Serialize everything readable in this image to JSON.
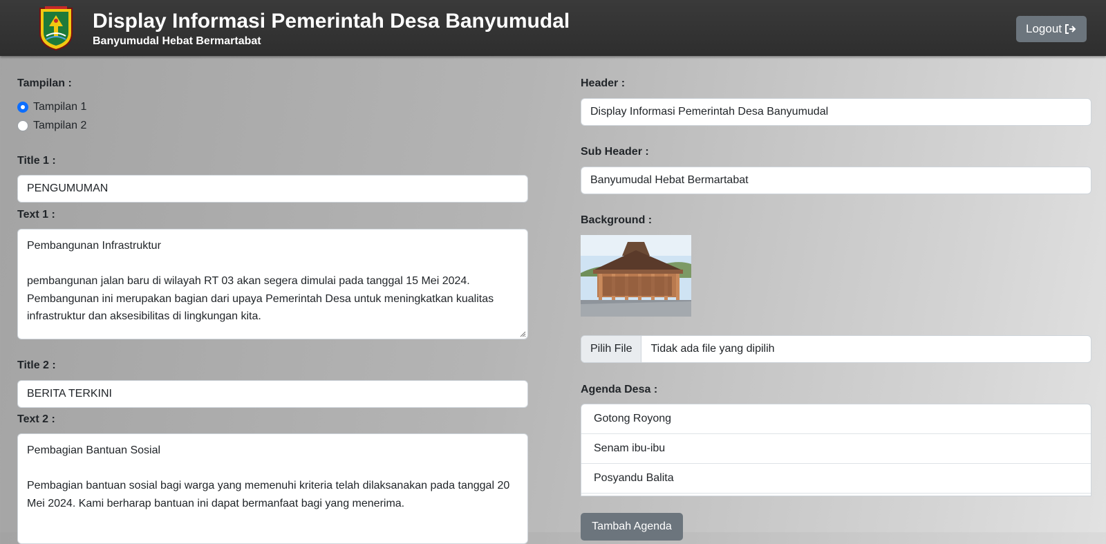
{
  "header": {
    "title": "Display Informasi Pemerintah Desa Banyumudal",
    "subtitle": "Banyumudal Hebat Bermartabat",
    "logout_label": "Logout",
    "logo_icon": "village-emblem-icon",
    "logout_icon": "sign-out-icon"
  },
  "left": {
    "tampilan_label": "Tampilan :",
    "options": [
      {
        "label": "Tampilan 1",
        "selected": true
      },
      {
        "label": "Tampilan 2",
        "selected": false
      }
    ],
    "title1_label": "Title 1 :",
    "title1_value": "PENGUMUMAN",
    "text1_label": "Text 1 :",
    "text1_heading": "Pembangunan Infrastruktur",
    "text1_body": "pembangunan jalan baru di wilayah RT 03 akan segera dimulai pada tanggal 15 Mei 2024. Pembangunan ini merupakan bagian dari upaya Pemerintah Desa untuk meningkatkan kualitas infrastruktur dan aksesibilitas di lingkungan kita.",
    "title2_label": "Title 2 :",
    "title2_value": "BERITA TERKINI",
    "text2_label": "Text 2 :",
    "text2_heading": "Pembagian Bantuan Sosial",
    "text2_body": "Pembagian bantuan sosial bagi warga yang memenuhi kriteria telah dilaksanakan pada tanggal 20 Mei 2024. Kami berharap bantuan ini dapat bermanfaat bagi yang menerima."
  },
  "right": {
    "header_label": "Header :",
    "header_value": "Display Informasi Pemerintah Desa Banyumudal",
    "subheader_label": "Sub Header :",
    "subheader_value": "Banyumudal Hebat Bermartabat",
    "background_label": "Background :",
    "file_button_label": "Pilih File",
    "file_status": "Tidak ada file yang dipilih",
    "agenda_label": "Agenda Desa :",
    "agenda_items": [
      "Gotong Royong",
      "Senam ibu-ibu",
      "Posyandu Balita"
    ],
    "add_agenda_label": "Tambah Agenda"
  },
  "colors": {
    "topbar": "#2e2e2e",
    "secondary_button": "#6c757d",
    "radio_accent": "#0d6efd"
  }
}
